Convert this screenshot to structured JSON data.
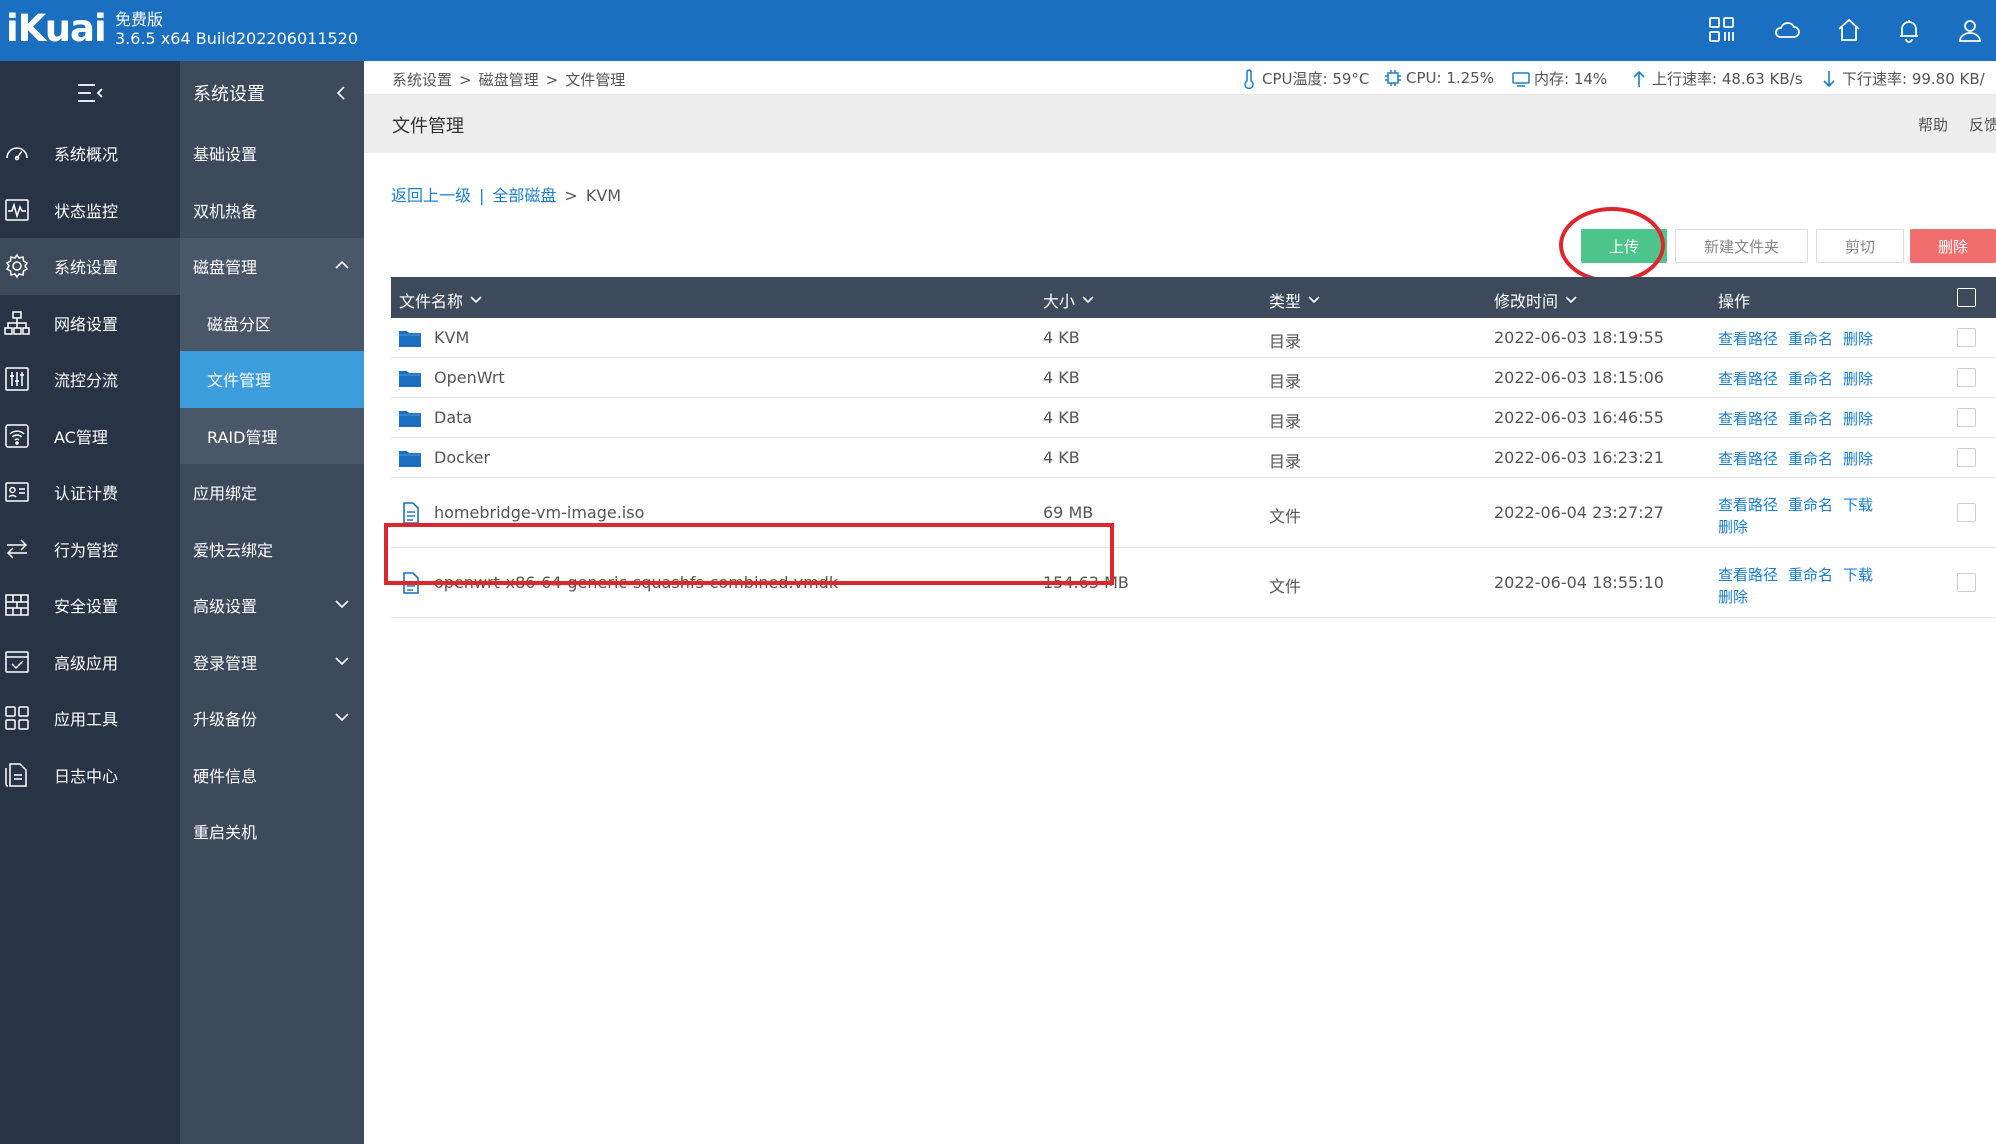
{
  "brand": {
    "logo": "iKuai",
    "edition": "免费版",
    "version": "3.6.5 x64 Build202206011520",
    "color": "#1a6fc0"
  },
  "top_icons": [
    "apps-grid-icon",
    "cloud-icon",
    "home-icon",
    "bell-icon",
    "user-icon"
  ],
  "nav1": {
    "items": [
      {
        "label": "系统概况",
        "icon": "dashboard-icon"
      },
      {
        "label": "状态监控",
        "icon": "pulse-icon"
      },
      {
        "label": "系统设置",
        "icon": "gear-icon",
        "active": true
      },
      {
        "label": "网络设置",
        "icon": "network-icon"
      },
      {
        "label": "流控分流",
        "icon": "sliders-icon"
      },
      {
        "label": "AC管理",
        "icon": "wifi-icon"
      },
      {
        "label": "认证计费",
        "icon": "id-card-icon"
      },
      {
        "label": "行为管控",
        "icon": "arrows-icon"
      },
      {
        "label": "安全设置",
        "icon": "firewall-icon"
      },
      {
        "label": "高级应用",
        "icon": "check-window-icon"
      },
      {
        "label": "应用工具",
        "icon": "tools-grid-icon"
      },
      {
        "label": "日志中心",
        "icon": "document-icon"
      }
    ]
  },
  "nav2": {
    "title": "系统设置",
    "items": [
      {
        "label": "基础设置"
      },
      {
        "label": "双机热备"
      },
      {
        "label": "磁盘管理",
        "expanded": true
      },
      {
        "label": "磁盘分区",
        "sub": true
      },
      {
        "label": "文件管理",
        "sub": true,
        "selected": true
      },
      {
        "label": "RAID管理",
        "sub": true
      },
      {
        "label": "应用绑定"
      },
      {
        "label": "爱快云绑定"
      },
      {
        "label": "高级设置",
        "has_children": true
      },
      {
        "label": "登录管理",
        "has_children": true
      },
      {
        "label": "升级备份",
        "has_children": true
      },
      {
        "label": "硬件信息"
      },
      {
        "label": "重启关机"
      }
    ]
  },
  "status": {
    "breadcrumb": [
      "系统设置",
      "磁盘管理",
      "文件管理"
    ],
    "cpu_temp": "CPU温度: 59°C",
    "cpu": "CPU: 1.25%",
    "memory": "内存: 14%",
    "upload": "上行速率: 48.63 KB/s",
    "download": "下行速率: 99.80 KB/"
  },
  "page": {
    "title": "文件管理",
    "help": "帮助",
    "feedback": "反馈"
  },
  "path": {
    "back": "返回上一级",
    "sep": "|",
    "all_disks": "全部磁盘",
    "arrow": ">",
    "current": "KVM"
  },
  "toolbar": {
    "upload": "上传",
    "new_folder": "新建文件夹",
    "cut": "剪切",
    "delete": "删除"
  },
  "table": {
    "headers": {
      "name": "文件名称",
      "size": "大小",
      "type": "类型",
      "mtime": "修改时间",
      "ops": "操作"
    },
    "rows": [
      {
        "name": "KVM",
        "size": "4 KB",
        "type": "目录",
        "mtime": "2022-06-03 18:19:55",
        "ops": [
          "查看路径",
          "重命名",
          "删除"
        ],
        "kind": "folder"
      },
      {
        "name": "OpenWrt",
        "size": "4 KB",
        "type": "目录",
        "mtime": "2022-06-03 18:15:06",
        "ops": [
          "查看路径",
          "重命名",
          "删除"
        ],
        "kind": "folder"
      },
      {
        "name": "Data",
        "size": "4 KB",
        "type": "目录",
        "mtime": "2022-06-03 16:46:55",
        "ops": [
          "查看路径",
          "重命名",
          "删除"
        ],
        "kind": "folder"
      },
      {
        "name": "Docker",
        "size": "4 KB",
        "type": "目录",
        "mtime": "2022-06-03 16:23:21",
        "ops": [
          "查看路径",
          "重命名",
          "删除"
        ],
        "kind": "folder"
      },
      {
        "name": "homebridge-vm-image.iso",
        "size": "69 MB",
        "type": "文件",
        "mtime": "2022-06-04 23:27:27",
        "ops": [
          "查看路径",
          "重命名",
          "下载",
          "删除"
        ],
        "kind": "file"
      },
      {
        "name": "openwrt-x86-64-generic-squashfs-combined.vmdk",
        "size": "154.63 MB",
        "type": "文件",
        "mtime": "2022-06-04 18:55:10",
        "ops": [
          "查看路径",
          "重命名",
          "下载",
          "删除"
        ],
        "kind": "file"
      }
    ]
  }
}
